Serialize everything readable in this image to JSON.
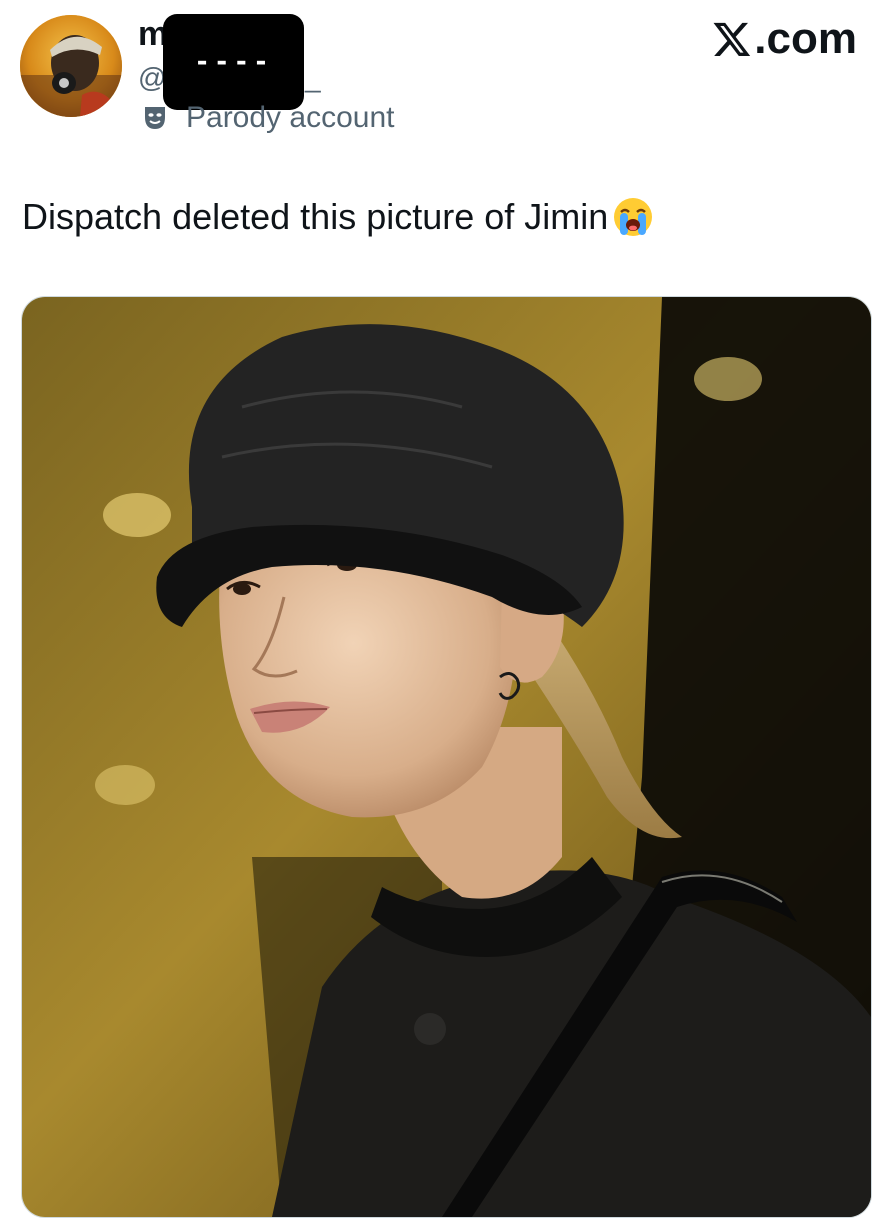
{
  "header": {
    "display_name_visible": "m",
    "handle_prefix": "@",
    "handle_suffix": "_",
    "redaction_text": "----",
    "parody_label": "Parody account",
    "parody_icon": "theater-masks-icon",
    "site_label": ".com",
    "site_logo": "x-logo-icon"
  },
  "tweet": {
    "text": "Dispatch deleted this picture of Jimin",
    "emoji": "loudly-crying-face-icon"
  },
  "media": {
    "subject": "photo-person-in-black-cap"
  },
  "colors": {
    "text_primary": "#0f1419",
    "text_secondary": "#536471",
    "redaction": "#000000",
    "photo_background": "#9a7a2a"
  }
}
